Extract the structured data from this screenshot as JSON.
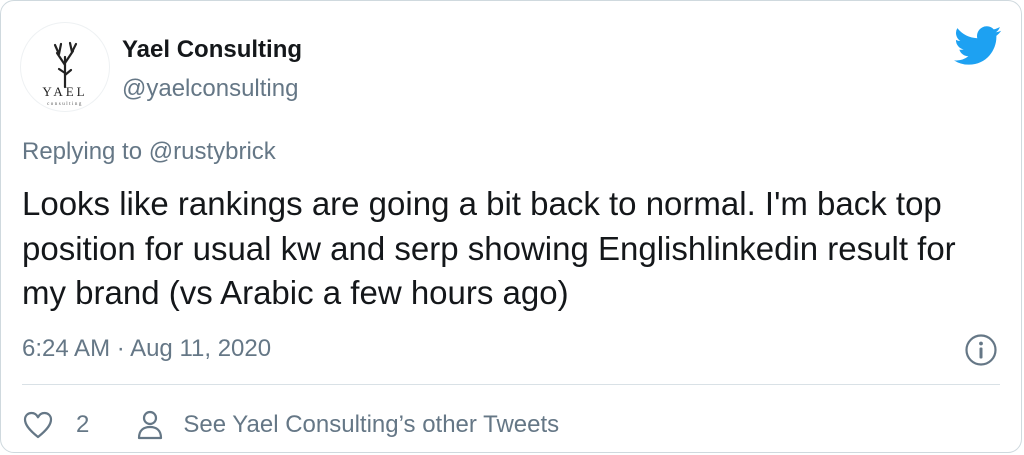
{
  "author": {
    "name": "Yael Consulting",
    "handle": "@yaelconsulting",
    "avatar_text": "YAEL",
    "avatar_subtext": "consulting"
  },
  "reply": {
    "prefix": "Replying to",
    "mention": "@rustybrick"
  },
  "tweet": {
    "text": "Looks like rankings are going a bit back to normal. I'm back top position for usual kw and serp showing Englishlinkedin result for my brand (vs Arabic a few hours ago)",
    "time": "6:24 AM",
    "separator": "·",
    "date": "Aug 11, 2020"
  },
  "actions": {
    "like_count": "2",
    "profile_link": "See Yael Consulting’s other Tweets"
  },
  "colors": {
    "twitter_blue": "#1da1f2",
    "secondary_text": "#657786",
    "primary_text": "#14171a",
    "border": "#cfd9de"
  },
  "icons": {
    "brand": "twitter-bird-icon",
    "info": "info-icon",
    "like": "heart-icon",
    "profile": "person-icon"
  }
}
